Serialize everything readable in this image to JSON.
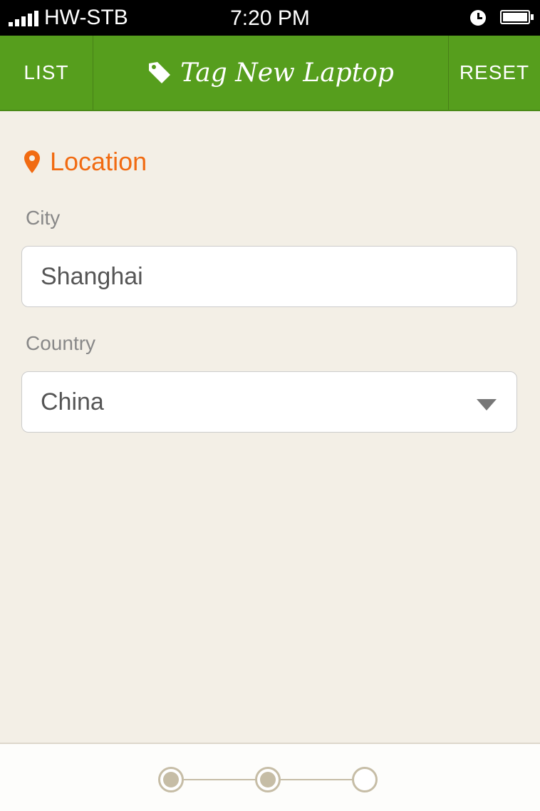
{
  "status_bar": {
    "carrier": "HW-STB",
    "time": "7:20 PM"
  },
  "nav": {
    "left_label": "LIST",
    "title": "Tag New Laptop",
    "right_label": "RESET"
  },
  "section": {
    "title": "Location"
  },
  "form": {
    "city_label": "City",
    "city_value": "Shanghai",
    "country_label": "Country",
    "country_value": "China"
  },
  "stepper": {
    "total_steps": 3,
    "completed_steps": 2
  },
  "colors": {
    "nav_green": "#569e1d",
    "accent_orange": "#f16b12",
    "background": "#f3efe6",
    "step_color": "#c6bda6"
  }
}
